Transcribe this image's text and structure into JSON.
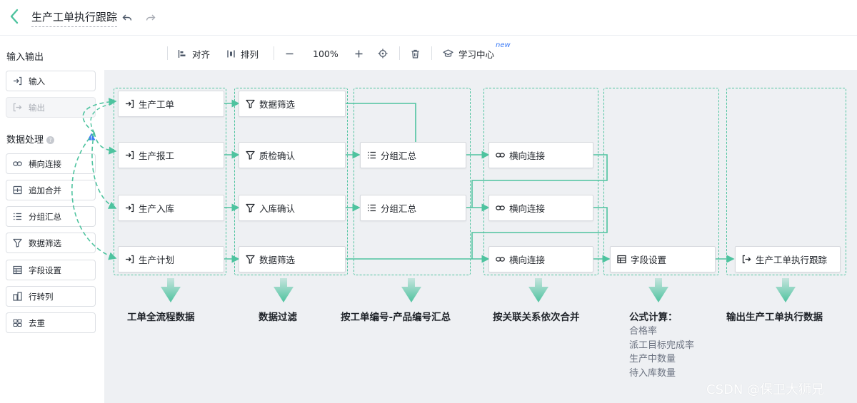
{
  "header": {
    "title": "生产工单执行跟踪",
    "back_icon": "chevron-left-icon"
  },
  "sidebar": {
    "io_heading": "输入输出",
    "io_items": [
      {
        "label": "输入",
        "icon": "input-arrow-icon"
      },
      {
        "label": "输出",
        "icon": "output-arrow-icon",
        "disabled": true
      }
    ],
    "proc_heading": "数据处理",
    "proc_items": [
      {
        "label": "横向连接",
        "icon": "link-icon"
      },
      {
        "label": "追加合并",
        "icon": "append-icon"
      },
      {
        "label": "分组汇总",
        "icon": "list-icon"
      },
      {
        "label": "数据筛选",
        "icon": "filter-icon"
      },
      {
        "label": "字段设置",
        "icon": "table-icon"
      },
      {
        "label": "行转列",
        "icon": "pivot-icon"
      },
      {
        "label": "去重",
        "icon": "dedupe-icon"
      }
    ]
  },
  "toolbar": {
    "align_label": "对齐",
    "arrange_label": "排列",
    "zoom": "100%",
    "learn_label": "学习中心",
    "new_badge": "new"
  },
  "flow": {
    "col1": [
      "生产工单",
      "生产报工",
      "生产入库",
      "生产计划"
    ],
    "col2": [
      "数据筛选",
      "质检确认",
      "入库确认",
      "数据筛选"
    ],
    "col3": [
      "分组汇总",
      "分组汇总"
    ],
    "col4": [
      "横向连接",
      "横向连接",
      "横向连接"
    ],
    "col5": [
      "字段设置"
    ],
    "col6": [
      "生产工单执行跟踪"
    ]
  },
  "captions": [
    "工单全流程数据",
    "数据过滤",
    "按工单编号-产品编号汇总",
    "按关联关系依次合并",
    "公式计算：",
    "输出生产工单执行数据"
  ],
  "formula_items": [
    "合格率",
    "派工目标完成率",
    "生产中数量",
    "待入库数量"
  ],
  "watermark": "CSDN @保卫大狮兄",
  "colors": {
    "accent": "#4ec39f",
    "canvas_bg": "#eef0f3",
    "new_badge": "#3c7bf6"
  }
}
